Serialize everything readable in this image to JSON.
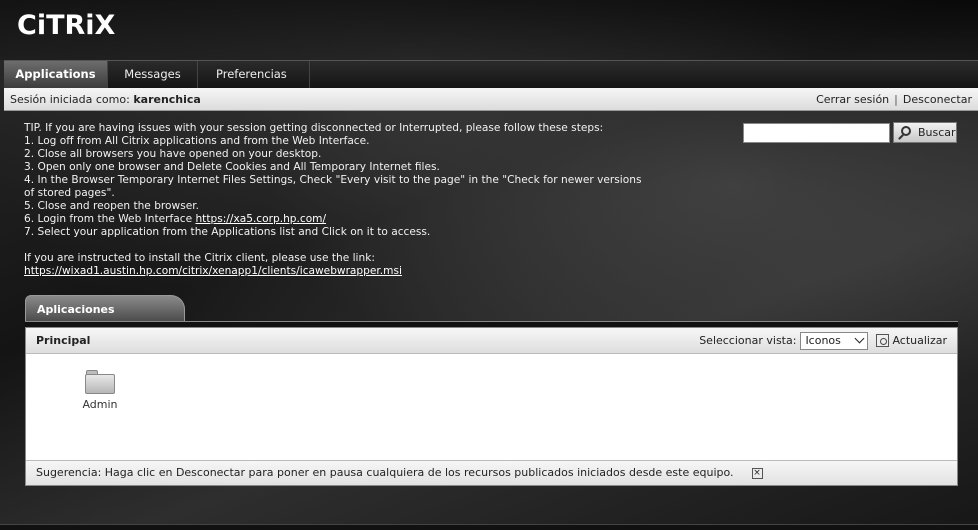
{
  "header": {
    "logo_text": "CiTRiX"
  },
  "nav": {
    "tabs": [
      {
        "label": "Applications",
        "active": true
      },
      {
        "label": "Messages",
        "active": false
      },
      {
        "label": "Preferencias",
        "active": false,
        "has_dropdown": true
      }
    ]
  },
  "userbar": {
    "prefix": "Sesión iniciada como:",
    "username": "karenchica",
    "logoff": "Cerrar sesión",
    "disconnect": "Desconectar"
  },
  "tip": {
    "lines": [
      "TIP. If you are having issues with your session getting disconnected or Interrupted, please follow these steps:",
      "1. Log off from All Citrix applications and from the Web Interface.",
      "2. Close all browsers you have opened on your desktop.",
      "3. Open only one browser and Delete Cookies and All Temporary Internet files.",
      "4. In the Browser Temporary Internet Files Settings, Check \"Every visit to the page\" in the \"Check for newer versions of stored pages\".",
      "5. Close and reopen the browser.",
      "6. Login from the Web Interface ",
      "7. Select your application from the Applications list and Click on it to access."
    ],
    "login_link": "https://xa5.corp.hp.com/",
    "install_text": "If you are instructed to install the Citrix client, please use the link:",
    "install_link": "https://wixad1.austin.hp.com/citrix/xenapp1/clients/icawebwrapper.msi"
  },
  "search": {
    "value": "",
    "button_label": "Buscar"
  },
  "panel": {
    "tab_label": "Aplicaciones",
    "section_title": "Principal",
    "view_label": "Seleccionar vista:",
    "view_selected": "Iconos",
    "refresh_label": "Actualizar",
    "apps": [
      {
        "name": "Admin",
        "icon": "folder-icon"
      }
    ],
    "footer_hint": "Sugerencia: Haga clic en Desconectar para poner en pausa cualquiera de los recursos publicados iniciados desde este equipo."
  }
}
